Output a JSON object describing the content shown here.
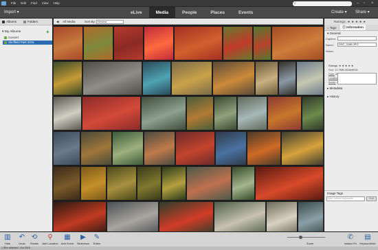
{
  "menubar": {
    "items": [
      "File",
      "Edit",
      "Find",
      "View",
      "Help"
    ],
    "search_placeholder": ""
  },
  "modebar": {
    "import": "Import ▾",
    "tabs": [
      {
        "label": "eLive",
        "active": false
      },
      {
        "label": "Media",
        "active": true
      },
      {
        "label": "People",
        "active": false
      },
      {
        "label": "Places",
        "active": false
      },
      {
        "label": "Events",
        "active": false
      }
    ],
    "create": "Create ▾",
    "share": "Share ▾"
  },
  "left_panel": {
    "tabs": [
      "Albums",
      "Folders"
    ],
    "section": "My Albums",
    "albums": [
      {
        "name": "Concert",
        "selected": false
      },
      {
        "name": "Sheffield Park 2015",
        "selected": true
      }
    ]
  },
  "grid_bar": {
    "back_label": "◀",
    "location": "All Media",
    "sort_label": "Sort By:",
    "sort_value": "Newest"
  },
  "ratings_label": "Ratings: ★ ★ ★ ★ ★",
  "right_panel": {
    "tabs": [
      "Tags",
      "Information"
    ],
    "general": "General",
    "caption_label": "Caption:",
    "caption_value": "",
    "name_label": "Name:",
    "name_value": "DSC_0186.JPG",
    "notes_label": "Notes:",
    "ratings_label": "Ratings: ★ ★ ★ ★ ★",
    "size_label": "Size:",
    "size_value": "17.7MB  4016x6016",
    "date_label": "Date:",
    "date_value": "20/10/2015 03:29",
    "location_label": "Location:",
    "location_value": "E:\\images\\20...Park\\JPEGS\\",
    "audio_label": "Audio:",
    "audio_value": "<none>",
    "metadata": "Metadata",
    "history": "History",
    "image_tags": "Image Tags",
    "tag_placeholder": "Add Custom Keywords",
    "tag_add": "Add"
  },
  "bottom_bar": {
    "tools": [
      {
        "label": "Hide Panel",
        "icon": "panel-icon",
        "glyph": "▥"
      },
      {
        "label": "Undo",
        "icon": "undo-icon",
        "glyph": "↶"
      },
      {
        "label": "Rotate",
        "icon": "rotate-icon",
        "glyph": "⟲"
      },
      {
        "label": "Add Location",
        "icon": "location-pin-icon",
        "glyph": "⚲"
      },
      {
        "label": "Add Event",
        "icon": "calendar-icon",
        "glyph": "▦"
      },
      {
        "label": "Slideshow",
        "icon": "play-icon",
        "glyph": "▶"
      },
      {
        "label": "Editor",
        "icon": "editor-icon",
        "glyph": "✎"
      },
      {
        "label": "Instant Fix",
        "icon": "wrench-icon",
        "glyph": "✆"
      },
      {
        "label": "Keyword/Info",
        "icon": "keyword-info-icon",
        "glyph": "▤"
      }
    ],
    "zoom_label": "Zoom"
  },
  "status": "1 item selected / Oct 2015",
  "colors": {
    "menubar_bg": "#3a3a3a",
    "modebar_bg": "#4a4a4a",
    "selection_blue": "#2b6cb3",
    "panel_bg": "#ececec"
  },
  "thumbnail_rows": [
    [
      [
        "#a8472a",
        "#c77a3d"
      ],
      [
        "#b06a2a",
        "#7c8a3c"
      ],
      [
        "#b53a2c",
        "#8a2a25"
      ],
      [
        "#c02a3a",
        "#ff6a40"
      ],
      [
        "#a23022",
        "#d2602e"
      ],
      [
        "#66792f",
        "#c23a28"
      ],
      [
        "#4f7a32",
        "#b8422a"
      ],
      [
        "#a34a24",
        "#cf7d3a"
      ]
    ],
    [
      [
        "#3a4a2a",
        "#c49a36"
      ],
      [
        "#4e4e46",
        "#8e8e86"
      ],
      [
        "#2a4a5a",
        "#4fa3b2"
      ],
      [
        "#7a6a4a",
        "#caa24a"
      ],
      [
        "#5a4a3a",
        "#cc8a3a"
      ],
      [
        "#6a5a3a",
        "#c8b080"
      ],
      [
        "#34302a",
        "#8b9aa5"
      ],
      [
        "#6d7a8a",
        "#c6c8b2"
      ]
    ],
    [
      [
        "#5a5a52",
        "#cfcfc2"
      ],
      [
        "#8a2a2a",
        "#d44a38"
      ],
      [
        "#3e4e3a",
        "#90a090"
      ],
      [
        "#4a5e3a",
        "#b27a34"
      ],
      [
        "#3a4a32",
        "#8fa27c"
      ],
      [
        "#5e6a5a",
        "#a8b8b8"
      ],
      [
        "#8a3a32",
        "#c9772c"
      ],
      [
        "#2e3a2a",
        "#6f8a4c"
      ]
    ],
    [
      [
        "#3a4a5a",
        "#6a7a8a"
      ],
      [
        "#4a4a3a",
        "#a0763a"
      ],
      [
        "#3a5a3a",
        "#9fb07e"
      ],
      [
        "#4a4a42",
        "#c07a4a"
      ],
      [
        "#6a2a2a",
        "#c4442e"
      ],
      [
        "#303a4a",
        "#4a72a0"
      ],
      [
        "#4a3a2a",
        "#cf6a26"
      ],
      [
        "#3e3e32",
        "#d8a23c"
      ]
    ],
    [
      [
        "#3a2a1a",
        "#7a5a2a"
      ],
      [
        "#7a5a1a",
        "#c6902a"
      ],
      [
        "#4a4a1a",
        "#a89040"
      ],
      [
        "#3a3a1a",
        "#807830"
      ],
      [
        "#2a3a1a",
        "#b4a040"
      ],
      [
        "#4a5a4a",
        "#c07050"
      ],
      [
        "#364a2a",
        "#a4b68e"
      ],
      [
        "#5a1a12",
        "#d84a2a"
      ]
    ],
    [
      [
        "#2a1a12",
        "#c23a22"
      ],
      [
        "#4a4e52",
        "#a9a6a0"
      ],
      [
        "#2a3e2a",
        "#d23c28"
      ],
      [
        "#4e5e4a",
        "#c8c2b2"
      ],
      [
        "#6a6a5a",
        "#d8d2c2"
      ],
      [
        "#3a4a4a",
        "#8aa0a8"
      ],
      [
        "#2a3a2a",
        "#6e8a44"
      ]
    ]
  ]
}
